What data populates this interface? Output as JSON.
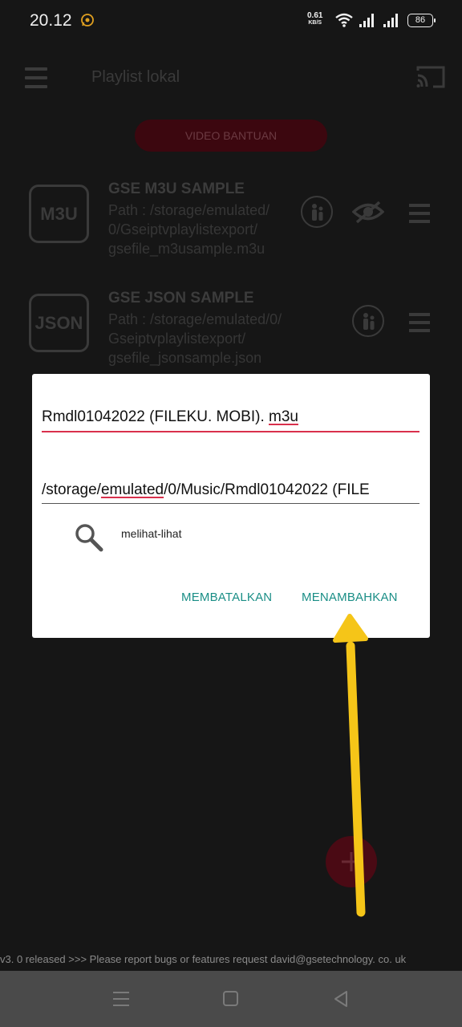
{
  "status": {
    "time": "20.12",
    "net_speed": "0.61",
    "net_unit": "KB/S",
    "battery": "86"
  },
  "appbar": {
    "title": "Playlist lokal"
  },
  "video_help_label": "VIDEO BANTUAN",
  "playlists": [
    {
      "icon_text": "M3U",
      "title": "GSE M3U SAMPLE",
      "path_lines": [
        "Path : /storage/emulated/",
        "0/Gseiptvplaylistexport/",
        "gsefile_m3usample.m3u"
      ]
    },
    {
      "icon_text": "JSON",
      "title": "GSE JSON SAMPLE",
      "path_lines": [
        "Path : /storage/emulated/0/",
        "Gseiptvplaylistexport/",
        "gsefile_jsonsample.json"
      ]
    }
  ],
  "dialog": {
    "name_value_prefix": "Rmdl01042022 (FILEKU. MOBI). ",
    "name_value_ext": "m3u",
    "path_prefix": "/storage/",
    "path_underlined": "emulated",
    "path_suffix": "/0/Music/Rmdl01042022 (FILE",
    "browse_label": "melihat-lihat",
    "cancel_label": "MEMBATALKAN",
    "add_label": "MENAMBAHKAN"
  },
  "ticker": "v3. 0 released >>>  Please report bugs or features request david@gsetechnology. co. uk",
  "colors": {
    "accent_teal": "#1a8e86",
    "underline_red": "#d9304c",
    "annotation_arrow": "#f5c518"
  }
}
